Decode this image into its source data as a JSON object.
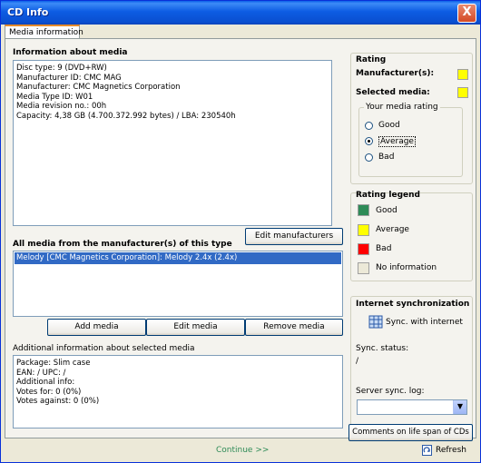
{
  "window": {
    "title": "CD Info",
    "close_glyph": "X"
  },
  "tabs": [
    {
      "label": "Media information"
    }
  ],
  "info": {
    "title": "Information about media",
    "lines": [
      "Disc type: 9 (DVD+RW)",
      "Manufacturer ID: CMC MAG",
      "Manufacturer: CMC Magnetics Corporation",
      "Media Type ID: W01",
      "Media revision no.: 00h",
      "Capacity: 4,38 GB (4.700.372.992 bytes) / LBA: 230540h"
    ],
    "edit_manufacturers": "Edit manufacturers"
  },
  "all_media": {
    "title": "All media from the manufacturer(s) of this type",
    "items": [
      "Melody [CMC Magnetics Corporation]: Melody 2.4x (2.4x)"
    ],
    "add": "Add media",
    "edit": "Edit media",
    "remove": "Remove media"
  },
  "additional": {
    "title": "Additional information about selected media",
    "lines": [
      "Package: Slim case",
      "EAN: / UPC: /",
      "Additional info:",
      "Votes for: 0 (0%)",
      "Votes against: 0 (0%)"
    ]
  },
  "rating": {
    "title": "Rating",
    "manufacturers_label": "Manufacturer(s):",
    "selected_label": "Selected media:",
    "manufacturers_color": "#ffff00",
    "selected_color": "#ffff00",
    "your_rating_title": "Your media rating",
    "options": [
      "Good",
      "Average",
      "Bad"
    ],
    "selected_option": "Average"
  },
  "legend": {
    "title": "Rating legend",
    "items": [
      {
        "label": "Good",
        "color": "#2e8b57"
      },
      {
        "label": "Average",
        "color": "#ffff00"
      },
      {
        "label": "Bad",
        "color": "#ff0000"
      },
      {
        "label": "No information",
        "color": "#ece9d8"
      }
    ]
  },
  "sync": {
    "title": "Internet synchronization",
    "sync_button": "Sync. with internet",
    "status_label": "Sync. status:",
    "status_value": "/",
    "log_label": "Server sync. log:",
    "log_value": ""
  },
  "comments_button": "Comments on life span of CDs",
  "footer": {
    "continue": "Continue >>",
    "refresh": "Refresh"
  }
}
